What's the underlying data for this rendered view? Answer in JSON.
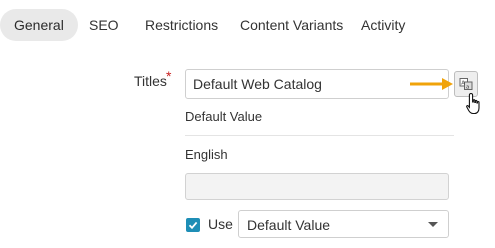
{
  "tabs": [
    {
      "label": "General",
      "active": true
    },
    {
      "label": "SEO",
      "active": false
    },
    {
      "label": "Restrictions",
      "active": false
    },
    {
      "label": "Content Variants",
      "active": false
    },
    {
      "label": "Activity",
      "active": false
    }
  ],
  "titles": {
    "label": "Titles",
    "required_marker": "*",
    "value": "Default Web Catalog",
    "translate_icon": "translate-icon"
  },
  "fallback": {
    "default_label": "Default Value",
    "locale_label": "English",
    "locale_value": "",
    "use_label": "Use",
    "use_checked": true,
    "select_value": "Default Value"
  },
  "colors": {
    "accent": "#1e8eb6",
    "arrow": "#f0a30a",
    "required": "#c81e1e",
    "active_tab_bg": "#e9e9e9"
  }
}
